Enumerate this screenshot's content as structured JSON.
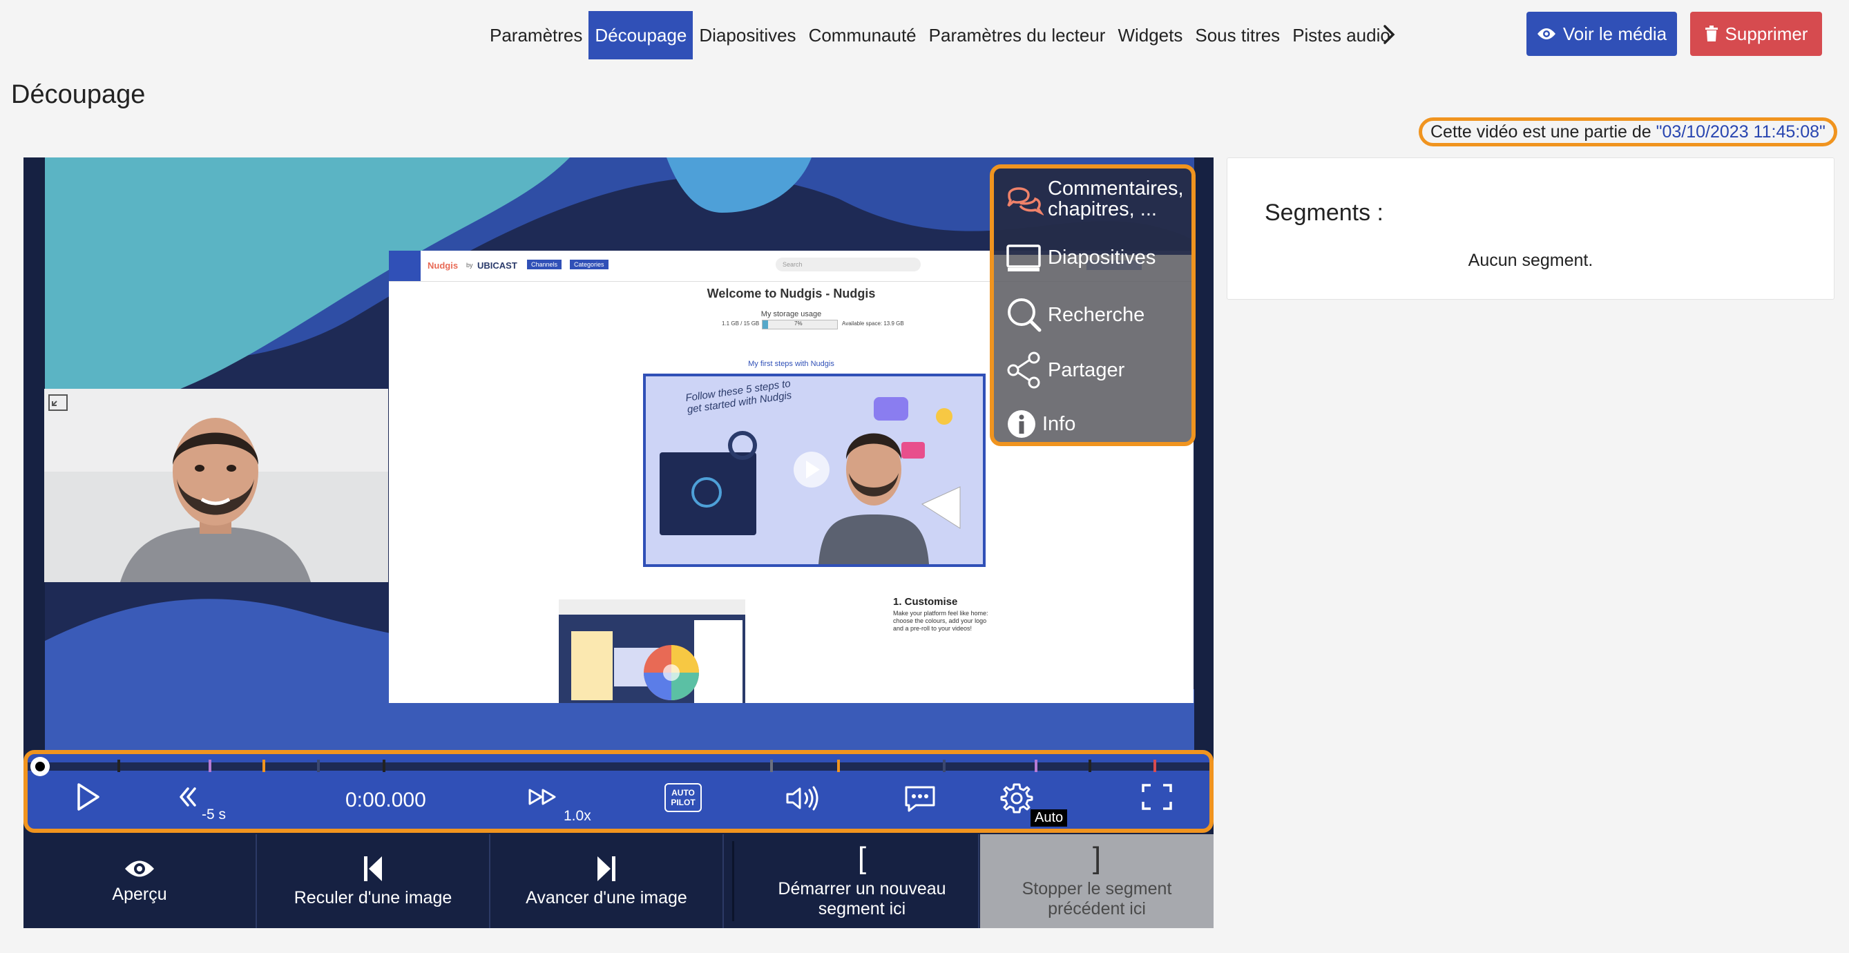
{
  "nav": {
    "tabs": [
      {
        "label": "Paramètres"
      },
      {
        "label": "Découpage"
      },
      {
        "label": "Diapositives"
      },
      {
        "label": "Communauté"
      },
      {
        "label": "Paramètres du lecteur"
      },
      {
        "label": "Widgets"
      },
      {
        "label": "Sous titres"
      },
      {
        "label": "Pistes audio"
      }
    ],
    "view_media": "Voir le média",
    "delete": "Supprimer"
  },
  "page": {
    "title": "Découpage",
    "parent_prefix": "Cette vidéo est une partie de ",
    "parent_link": "\"03/10/2023 11:45:08\""
  },
  "player": {
    "menu": {
      "comments": "Commentaires, chapitres, ...",
      "slides": "Diapositives",
      "search": "Recherche",
      "share": "Partager",
      "info": "Info"
    },
    "controls": {
      "rewind": "-5 s",
      "time": "0:00.000",
      "speed": "1.0x",
      "autopilot_line1": "AUTO",
      "autopilot_line2": "PILOT",
      "quality": "Auto"
    },
    "edit": {
      "preview": "Aperçu",
      "prev_frame": "Reculer d'une image",
      "next_frame": "Avancer d'une image",
      "start_segment": "Démarrer un nouveau segment ici",
      "stop_segment": "Stopper le segment précédent ici"
    }
  },
  "slide": {
    "brand": "Nudgis",
    "brand_by": "by",
    "company": "UBICAST",
    "channels": "Channels",
    "categories": "Categories",
    "search": "Search",
    "welcome": "Welcome to Nudgis - Nudgis",
    "storage": "My storage usage",
    "storage_used": "1.1 GB / 15 GB",
    "storage_pct": "7%",
    "storage_avail": "Available space: 13.9 GB",
    "first_steps": "My first steps with Nudgis",
    "handwritten": "Follow these 5 steps to get started with Nudgis",
    "customise_title": "1. Customise",
    "customise_text": "Make your platform feel like home: choose the colours, add your logo and a pre-roll to your videos!"
  },
  "segments": {
    "title": "Segments :",
    "empty": "Aucun segment."
  },
  "colors": {
    "primary": "#3050b7",
    "danger": "#d64b4f",
    "highlight": "#f0941f",
    "link": "#2845b0"
  }
}
